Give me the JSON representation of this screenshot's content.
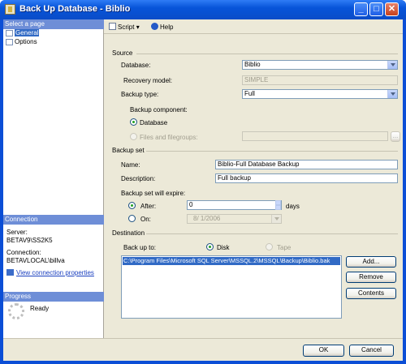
{
  "window": {
    "title": "Back Up Database - Biblio"
  },
  "left": {
    "select_page_header": "Select a page",
    "pages": [
      {
        "label": "General"
      },
      {
        "label": "Options"
      }
    ],
    "connection_header": "Connection",
    "server_label": "Server:",
    "server_value": "BETAV9\\SS2K5",
    "connection_label": "Connection:",
    "connection_value": "BETAVLOCAL\\billva",
    "view_props_link": "View connection properties",
    "progress_header": "Progress",
    "progress_status": "Ready"
  },
  "toolbar": {
    "script_label": "Script",
    "help_label": "Help"
  },
  "source": {
    "header": "Source",
    "database_label": "Database:",
    "database_value": "Biblio",
    "recovery_label": "Recovery model:",
    "recovery_value": "SIMPLE",
    "backup_type_label": "Backup type:",
    "backup_type_value": "Full",
    "component_label": "Backup component:",
    "component_database": "Database",
    "component_files": "Files and filegroups:",
    "files_button": "..."
  },
  "backup_set": {
    "header": "Backup set",
    "name_label": "Name:",
    "name_value": "Biblio-Full Database Backup",
    "description_label": "Description:",
    "description_value": "Full backup",
    "expire_label": "Backup set will expire:",
    "after_label": "After:",
    "after_value": "0",
    "days_label": "days",
    "on_label": "On:",
    "on_value": "8/  1/2006"
  },
  "destination": {
    "header": "Destination",
    "backup_to_label": "Back up to:",
    "disk_label": "Disk",
    "tape_label": "Tape",
    "paths": [
      "C:\\Program Files\\Microsoft SQL Server\\MSSQL.2\\MSSQL\\Backup\\Biblio.bak"
    ],
    "add_button": "Add...",
    "remove_button": "Remove",
    "contents_button": "Contents"
  },
  "footer": {
    "ok_button": "OK",
    "cancel_button": "Cancel"
  }
}
